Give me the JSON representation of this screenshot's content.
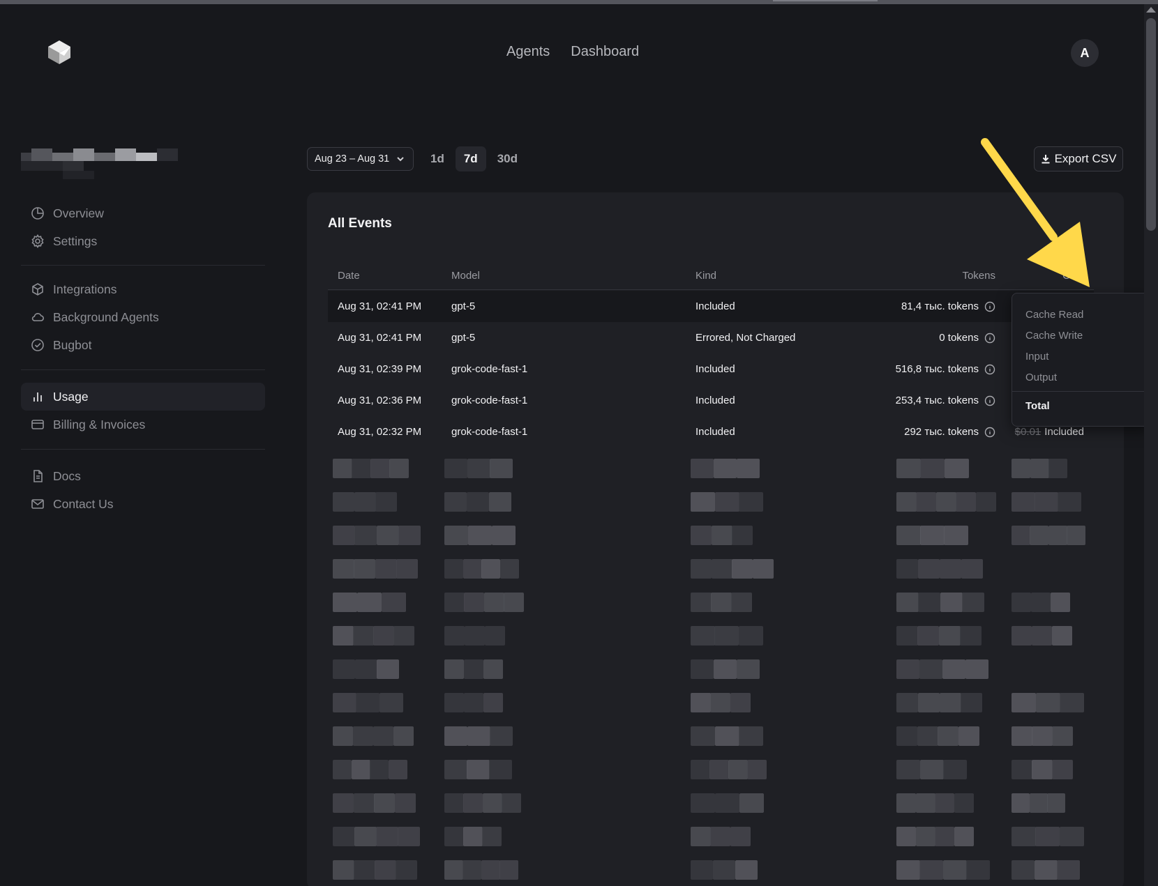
{
  "header": {
    "nav": [
      "Agents",
      "Dashboard"
    ],
    "avatar_initial": "A"
  },
  "sidebar": {
    "groups": [
      [
        {
          "label": "Overview",
          "icon": "pie-chart-icon"
        },
        {
          "label": "Settings",
          "icon": "gear-icon"
        }
      ],
      [
        {
          "label": "Integrations",
          "icon": "cube-icon"
        },
        {
          "label": "Background Agents",
          "icon": "cloud-icon"
        },
        {
          "label": "Bugbot",
          "icon": "check-circle-icon"
        }
      ],
      [
        {
          "label": "Usage",
          "icon": "bar-chart-icon",
          "active": true
        },
        {
          "label": "Billing & Invoices",
          "icon": "credit-card-icon"
        }
      ],
      [
        {
          "label": "Docs",
          "icon": "document-icon"
        },
        {
          "label": "Contact Us",
          "icon": "mail-icon"
        }
      ]
    ]
  },
  "toolbar": {
    "date_range": "Aug 23 – Aug 31",
    "ranges": [
      "1d",
      "7d",
      "30d"
    ],
    "selected_range": "7d",
    "export_label": "Export CSV"
  },
  "events": {
    "title": "All Events",
    "columns": {
      "date": "Date",
      "model": "Model",
      "kind": "Kind",
      "tokens": "Tokens",
      "cost": "Cost"
    },
    "rows": [
      {
        "date": "Aug 31, 02:41 PM",
        "model": "gpt-5",
        "kind": "Included",
        "tokens": "81,4 тыс. tokens",
        "cost_old": "",
        "cost": ""
      },
      {
        "date": "Aug 31, 02:41 PM",
        "model": "gpt-5",
        "kind": "Errored, Not Charged",
        "tokens": "0 tokens",
        "cost_old": "",
        "cost": ""
      },
      {
        "date": "Aug 31, 02:39 PM",
        "model": "grok-code-fast-1",
        "kind": "Included",
        "tokens": "516,8 тыс. tokens",
        "cost_old": "",
        "cost": ""
      },
      {
        "date": "Aug 31, 02:36 PM",
        "model": "grok-code-fast-1",
        "kind": "Included",
        "tokens": "253,4 тыс. tokens",
        "cost_old": "",
        "cost": ""
      },
      {
        "date": "Aug 31, 02:32 PM",
        "model": "grok-code-fast-1",
        "kind": "Included",
        "tokens": "292 тыс. tokens",
        "cost_old": "$0.01",
        "cost": "Included"
      }
    ]
  },
  "token_popover": {
    "items": [
      "Cache Read",
      "Cache Write",
      "Input",
      "Output"
    ],
    "total_label": "Total"
  },
  "colors": {
    "background": "#17181c",
    "card": "#1f2025",
    "annotation_arrow": "#ffd84a"
  }
}
